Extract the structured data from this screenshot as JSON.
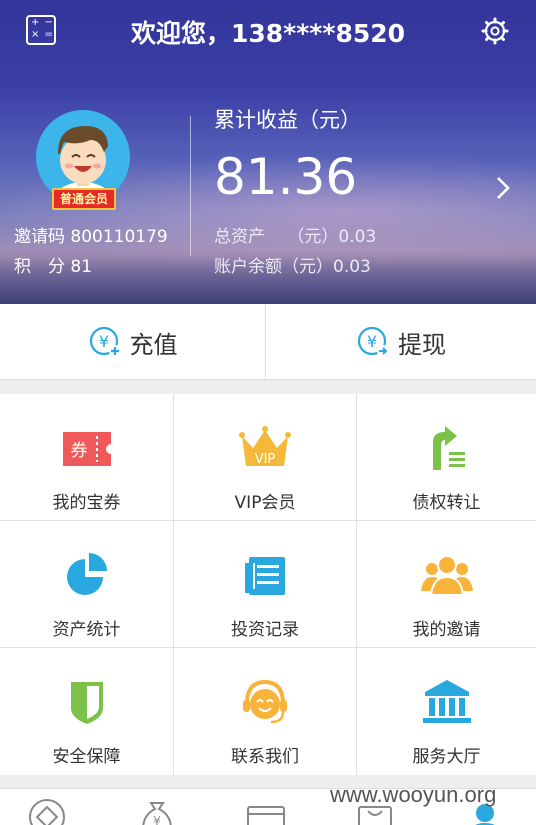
{
  "header": {
    "title": "欢迎您，138****8520",
    "member_badge": "普通会员",
    "invite_line": "邀请码 800110179",
    "points_line": "积　分 81",
    "earnings_label": "累计收益（元）",
    "earnings_value": "81.36",
    "total_assets_line": "总资产　 （元）0.03",
    "balance_line": "账户余额（元）0.03"
  },
  "actions": {
    "recharge": "充值",
    "withdraw": "提现"
  },
  "grid": {
    "items": [
      {
        "label": "我的宝券",
        "icon": "coupon-icon"
      },
      {
        "label": "VIP会员",
        "icon": "crown-icon"
      },
      {
        "label": "债权转让",
        "icon": "transfer-icon"
      },
      {
        "label": "资产统计",
        "icon": "pie-chart-icon"
      },
      {
        "label": "投资记录",
        "icon": "record-icon"
      },
      {
        "label": "我的邀请",
        "icon": "invite-users-icon"
      },
      {
        "label": "安全保障",
        "icon": "shield-icon"
      },
      {
        "label": "联系我们",
        "icon": "headset-icon"
      },
      {
        "label": "服务大厅",
        "icon": "bank-icon"
      }
    ],
    "crown_text": "VIP",
    "coupon_text": "券"
  },
  "bottom_nav": {
    "icons": [
      "home-icon",
      "money-bag-icon",
      "card-icon",
      "bag-icon",
      "user-icon"
    ]
  },
  "watermark": "www.wooyun.org",
  "colors": {
    "accent_blue": "#29a8e0",
    "coupon_red": "#f0595a",
    "vip_gold": "#f4b93a",
    "shield_green": "#7cc24a",
    "invite_orange": "#f9b33a"
  }
}
